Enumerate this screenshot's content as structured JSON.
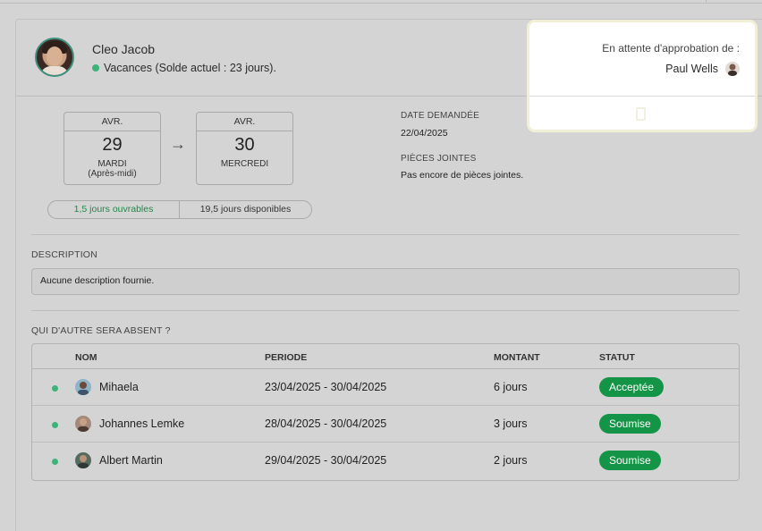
{
  "employee": {
    "name": "Cleo Jacob",
    "status": "Vacances (Solde actuel : 23 jours)."
  },
  "dates": {
    "start": {
      "month": "AVR.",
      "day": "29",
      "weekday": "MARDI",
      "part": "(Après-midi)"
    },
    "arrow": "→",
    "end": {
      "month": "AVR.",
      "day": "30",
      "weekday": "MERCREDI"
    }
  },
  "pill": {
    "working_days": "1,5 jours ouvrables",
    "available_days": "19,5 jours disponibles"
  },
  "meta": {
    "requested_label": "DATE DEMANDÉE",
    "requested_value": "22/04/2025",
    "attachments_label": "PIÈCES JOINTES",
    "attachments_value": "Pas encore de pièces jointes."
  },
  "description": {
    "label": "DESCRIPTION",
    "value": "Aucune description fournie."
  },
  "others": {
    "label": "QUI D'AUTRE SERA ABSENT ?",
    "columns": {
      "name": "NOM",
      "period": "PERIODE",
      "amount": "MONTANT",
      "status": "STATUT"
    },
    "rows": [
      {
        "name": "Mihaela",
        "period": "23/04/2025 - 30/04/2025",
        "amount": "6 jours",
        "status": "Acceptée"
      },
      {
        "name": "Johannes Lemke",
        "period": "28/04/2025 - 30/04/2025",
        "amount": "3 jours",
        "status": "Soumise"
      },
      {
        "name": "Albert Martin",
        "period": "29/04/2025 - 30/04/2025",
        "amount": "2 jours",
        "status": "Soumise"
      }
    ]
  },
  "approval": {
    "label": "En attente d'approbation de :",
    "approver": "Paul Wells"
  },
  "colors": {
    "accent_green": "#149446",
    "status_dot": "#3db37a"
  }
}
